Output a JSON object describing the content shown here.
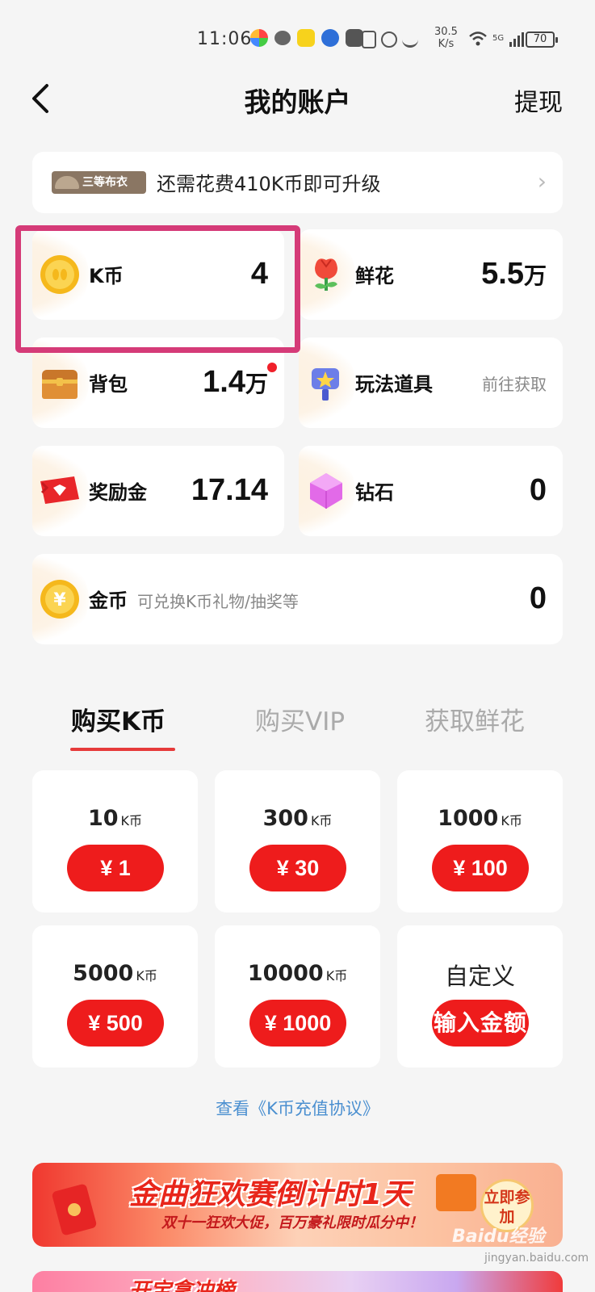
{
  "status_bar": {
    "time": "11:06",
    "net_speed": "30.5",
    "net_unit": "K/s",
    "battery": "70",
    "signal": "5G"
  },
  "nav": {
    "title": "我的账户",
    "withdraw_label": "提现"
  },
  "level": {
    "badge": "三等布衣",
    "text": "还需花费410K币即可升级"
  },
  "assets": {
    "kcoin": {
      "label": "K币",
      "value": "4"
    },
    "flowers": {
      "label": "鲜花",
      "value": "5.5",
      "unit": "万"
    },
    "bag": {
      "label": "背包",
      "value": "1.4",
      "unit": "万"
    },
    "props": {
      "label": "玩法道具",
      "action": "前往获取"
    },
    "reward": {
      "label": "奖励金",
      "value": "17.14"
    },
    "diamond": {
      "label": "钻石",
      "value": "0"
    },
    "gold": {
      "label": "金币",
      "hint": "可兑换K币礼物/抽奖等",
      "value": "0"
    }
  },
  "tabs": [
    {
      "label": "购买K币",
      "active": true
    },
    {
      "label": "购买VIP",
      "active": false
    },
    {
      "label": "获取鲜花",
      "active": false
    }
  ],
  "packs": [
    {
      "amount": "10",
      "unit": "K币",
      "price": "¥ 1"
    },
    {
      "amount": "300",
      "unit": "K币",
      "price": "¥ 30"
    },
    {
      "amount": "1000",
      "unit": "K币",
      "price": "¥ 100"
    },
    {
      "amount": "5000",
      "unit": "K币",
      "price": "¥ 500"
    },
    {
      "amount": "10000",
      "unit": "K币",
      "price": "¥ 1000"
    }
  ],
  "custom_pack": {
    "label": "自定义",
    "button": "输入金额"
  },
  "agreement": "查看《K币充值协议》",
  "banner1": {
    "title": "金曲狂欢赛倒计时1天",
    "subtitle": "双十一狂欢大促，百万豪礼限时瓜分中！",
    "button": "立即参加"
  },
  "banner2": {
    "title": "开宝拿冲榜"
  },
  "watermark": {
    "brand": "Baidu经验",
    "url": "jingyan.baidu.com"
  },
  "colors": {
    "accent_red": "#ee1c1c",
    "highlight": "#d53b78",
    "link": "#4a8fd0"
  }
}
